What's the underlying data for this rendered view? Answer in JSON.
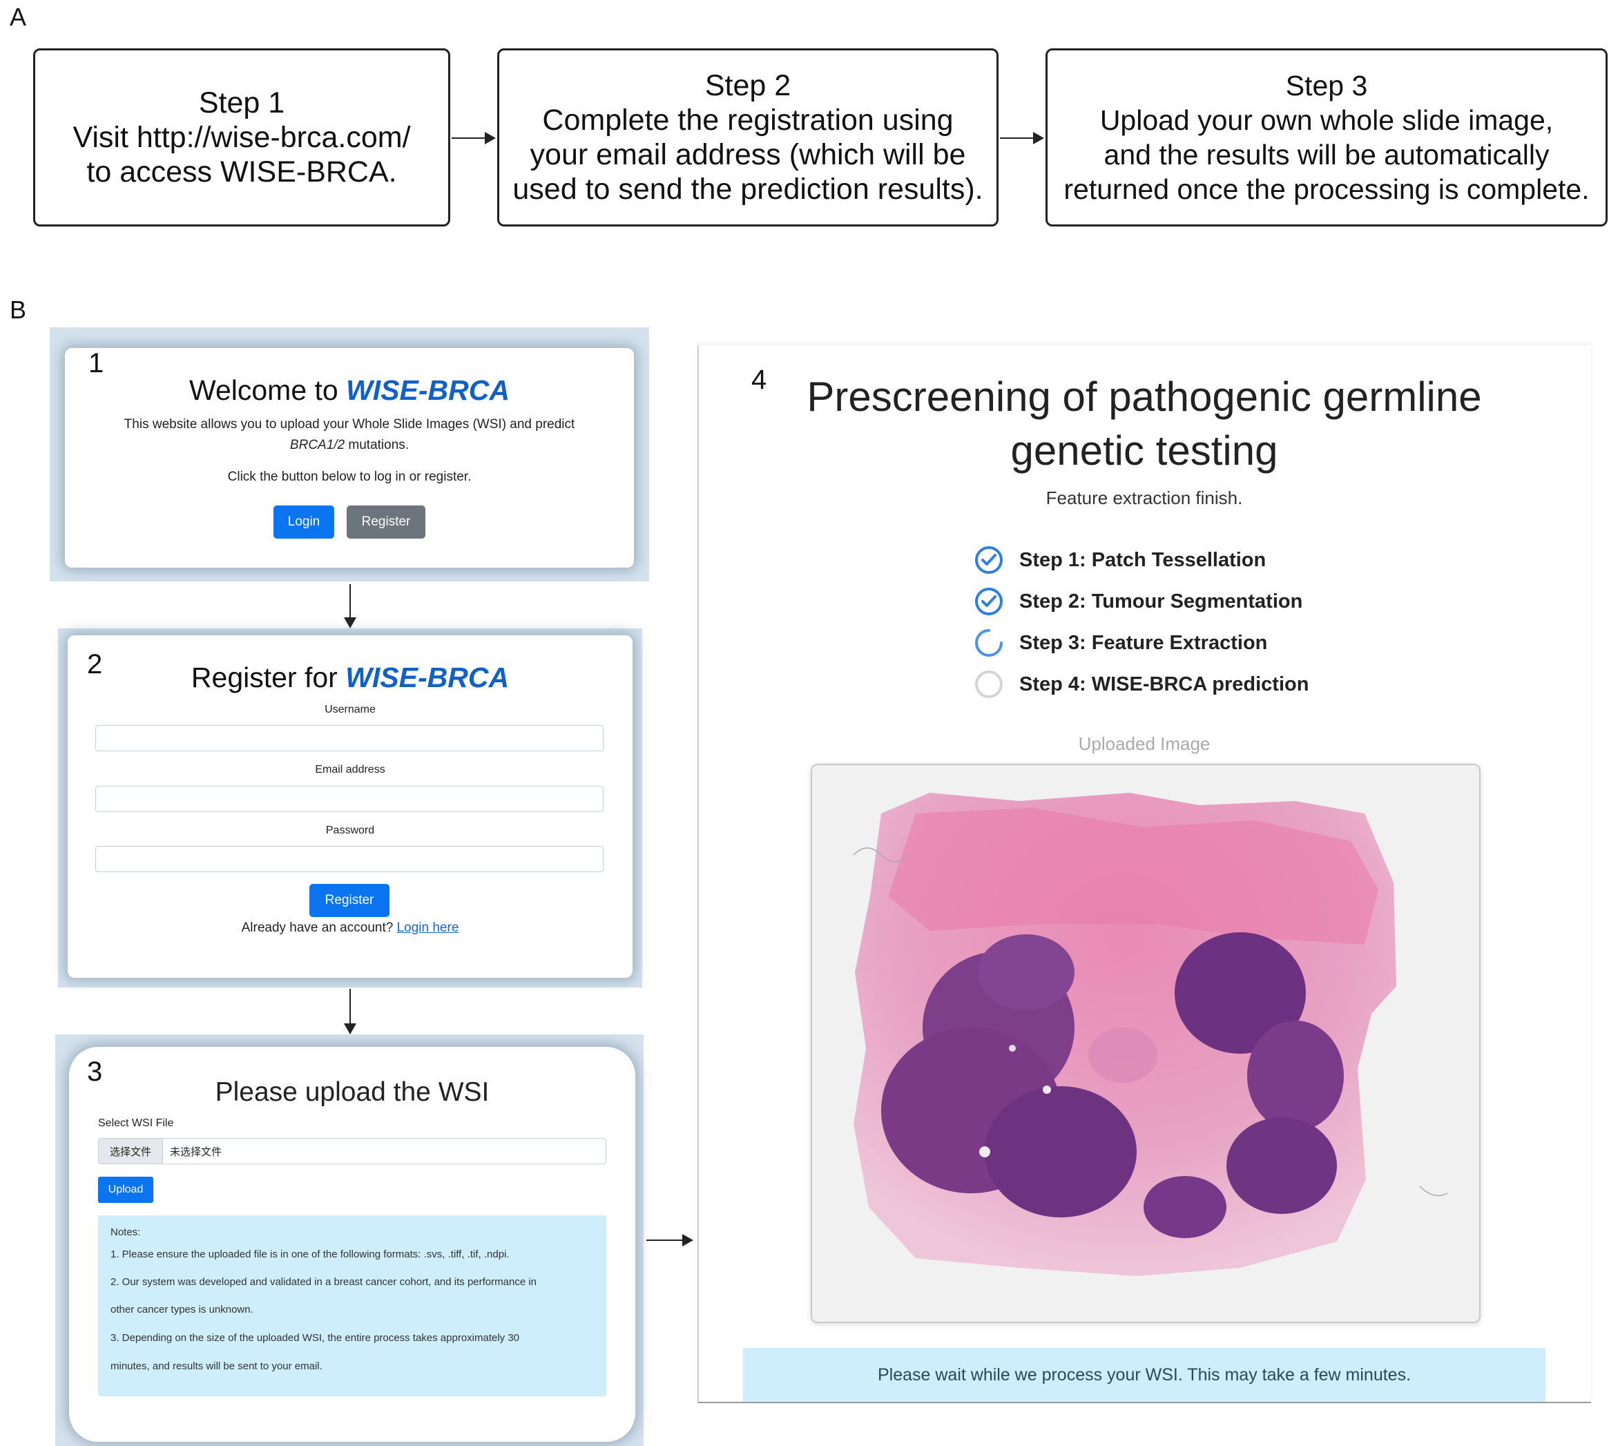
{
  "panel_a": {
    "label": "A",
    "steps": [
      {
        "title": "Step 1",
        "lines": [
          "Visit http://wise-brca.com/",
          "to access WISE-BRCA."
        ]
      },
      {
        "title": "Step 2",
        "lines": [
          "Complete the registration using",
          "your email address (which will be",
          "used to send the prediction results)."
        ]
      },
      {
        "title": "Step 3",
        "lines": [
          "Upload your own whole slide image,",
          "and the results will be automatically",
          "returned once the processing is complete."
        ]
      }
    ]
  },
  "panel_b": {
    "label": "B",
    "screen1": {
      "number": "1",
      "title_prefix": "Welcome to ",
      "brand": "WISE-BRCA",
      "desc_line1": "This website allows you to upload your Whole Slide Images (WSI) and predict",
      "desc_gene": "BRCA1/2",
      "desc_line2_suffix": " mutations.",
      "instruction": "Click the button below to log in or register.",
      "login_button": "Login",
      "register_button": "Register",
      "colors": {
        "primary": "#0b74f0",
        "secondary": "#6c757d"
      }
    },
    "screen2": {
      "number": "2",
      "title_prefix": "Register for ",
      "brand": "WISE-BRCA",
      "username_label": "Username",
      "email_label": "Email address",
      "password_label": "Password",
      "register_button": "Register",
      "account_prompt": "Already have an account? ",
      "login_link": "Login here"
    },
    "screen3": {
      "number": "3",
      "title": "Please upload the WSI",
      "file_label": "Select WSI File",
      "choose_button": "选择文件",
      "file_status": "未选择文件",
      "upload_button": "Upload",
      "notes_title": "Notes:",
      "notes": [
        "1. Please ensure the uploaded file is in one of the following formats: .svs, .tiff, .tif, .ndpi.",
        "2. Our system was developed and validated in a breast cancer cohort, and its performance in",
        "other cancer types is unknown.",
        "3. Depending on the size of the uploaded WSI, the entire process takes approximately 30",
        "minutes, and results will be sent to your email."
      ]
    },
    "screen4": {
      "number": "4",
      "title_line1": "Prescreening of pathogenic germline",
      "title_line2": "genetic testing",
      "status": "Feature extraction finish.",
      "steps": [
        {
          "label": "Step 1: Patch Tessellation",
          "state": "done"
        },
        {
          "label": "Step 2: Tumour Segmentation",
          "state": "done"
        },
        {
          "label": "Step 3: Feature Extraction",
          "state": "in-progress"
        },
        {
          "label": "Step 4: WISE-BRCA prediction",
          "state": "pending"
        }
      ],
      "image_caption": "Uploaded Image",
      "wait_message": "Please wait while we process your WSI. This may take a few minutes.",
      "colors": {
        "check": "#2f7fe0",
        "banner": "#cdeefa"
      }
    }
  }
}
